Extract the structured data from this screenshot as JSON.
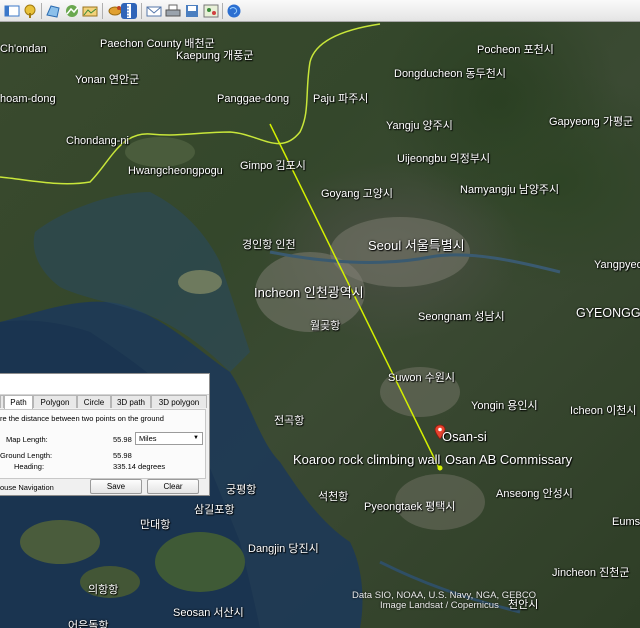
{
  "toolbar": {
    "buttons": [
      {
        "icon": "hide-sidebar-icon",
        "color": "#3b78c9"
      },
      {
        "icon": "add-placemark-icon",
        "color": "#e9c23a"
      },
      {
        "icon": "add-polygon-icon",
        "color": "#4a9ad8"
      },
      {
        "icon": "add-path-icon",
        "color": "#4a9ad8"
      },
      {
        "icon": "add-image-overlay-icon",
        "color": "#6aa84f"
      },
      {
        "icon": "record-tour-icon",
        "color": "#d08a2a"
      },
      {
        "icon": "historical-imagery-icon",
        "color": "#c9782d"
      },
      {
        "icon": "sun-icon",
        "color": "#e0a030"
      },
      {
        "icon": "switch-to-sky-icon",
        "color": "#7a5fb0"
      },
      {
        "icon": "ruler-icon",
        "color": "#2f64b8"
      },
      {
        "icon": "email-icon",
        "color": "#5577aa"
      },
      {
        "icon": "print-icon",
        "color": "#666666"
      },
      {
        "icon": "save-image-icon",
        "color": "#4c7fc0"
      },
      {
        "icon": "view-in-maps-icon",
        "color": "#3a8a3a"
      },
      {
        "icon": "globe-icon",
        "color": "#2c6fd1"
      }
    ]
  },
  "map": {
    "places": [
      {
        "id": "chondan",
        "label": "Ch'ondan"
      },
      {
        "id": "paechon",
        "label": "Paechon County 배천군"
      },
      {
        "id": "kaepung",
        "label": "Kaepung 개풍군"
      },
      {
        "id": "yonan",
        "label": "Yonan 연안군"
      },
      {
        "id": "hoam",
        "label": "hoam-dong"
      },
      {
        "id": "panggae",
        "label": "Panggae-dong"
      },
      {
        "id": "paju",
        "label": "Paju 파주시"
      },
      {
        "id": "pocheon",
        "label": "Pocheon 포천시"
      },
      {
        "id": "dongducheon",
        "label": "Dongducheon 동두천시"
      },
      {
        "id": "yangju",
        "label": "Yangju 양주시"
      },
      {
        "id": "gapyeong",
        "label": "Gapyeong 가평군"
      },
      {
        "id": "chondang",
        "label": "Chondang-ni"
      },
      {
        "id": "uijeongbu",
        "label": "Uijeongbu 의정부시"
      },
      {
        "id": "gimpo",
        "label": "Gimpo 김포시"
      },
      {
        "id": "hwangcheong",
        "label": "Hwangcheongpogu"
      },
      {
        "id": "namyangju",
        "label": "Namyangju 남양주시"
      },
      {
        "id": "goyang",
        "label": "Goyang 고양시"
      },
      {
        "id": "incheon-airport",
        "label": "경인항 인천"
      },
      {
        "id": "seoul",
        "label": "Seoul 서울특별시"
      },
      {
        "id": "yangpyeong",
        "label": "Yangpyeo"
      },
      {
        "id": "incheon",
        "label": "Incheon 인천광역시"
      },
      {
        "id": "seongnam",
        "label": "Seongnam 성남시"
      },
      {
        "id": "gyeonggi",
        "label": "GYEONGGI"
      },
      {
        "id": "wolgot",
        "label": "월곶항"
      },
      {
        "id": "suwon",
        "label": "Suwon 수원시"
      },
      {
        "id": "yongin",
        "label": "Yongin 용인시"
      },
      {
        "id": "icheon",
        "label": "Icheon 이천시"
      },
      {
        "id": "jeongok",
        "label": "전곡항"
      },
      {
        "id": "osan",
        "label": "Osan-si"
      },
      {
        "id": "koaroo",
        "label": "Koaroo rock climbing wall"
      },
      {
        "id": "osan-ab",
        "label": "Osan AB Commissary"
      },
      {
        "id": "anseong",
        "label": "Anseong 안성시"
      },
      {
        "id": "gungpyeong",
        "label": "궁평항"
      },
      {
        "id": "sokcho",
        "label": "석천항"
      },
      {
        "id": "pyeongtaek",
        "label": "Pyeongtaek 평택시"
      },
      {
        "id": "samgilpo",
        "label": "삼길포항"
      },
      {
        "id": "eums",
        "label": "Eums"
      },
      {
        "id": "mandae",
        "label": "만대항"
      },
      {
        "id": "dangjin",
        "label": "Dangjin 당진시"
      },
      {
        "id": "jincheon",
        "label": "Jincheon 진천군"
      },
      {
        "id": "uihang",
        "label": "의항항"
      },
      {
        "id": "seosan",
        "label": "Seosan 서산시"
      },
      {
        "id": "cheonan",
        "label": "천안시"
      },
      {
        "id": "eoeun",
        "label": "어은돌항"
      }
    ],
    "attribution_line1": "Data SIO, NOAA, U.S. Navy, NGA, GEBCO",
    "attribution_line2": "Image Landsat / Copernicus",
    "border_color": "#c8e63a",
    "measure_line_color": "#d4f000",
    "pin_color": "#e8432e"
  },
  "ruler": {
    "tabs": [
      "Path",
      "Polygon",
      "Circle",
      "3D path",
      "3D polygon"
    ],
    "instruction": "re the distance between two points on the ground",
    "map_length_label": "Map Length:",
    "map_length_value": "55.98",
    "units": "Miles",
    "ground_length_label": "Ground Length:",
    "ground_length_value": "55.98",
    "heading_label": "Heading:",
    "heading_value": "335.14 degrees",
    "mouse_navigation_label": "ouse Navigation",
    "save_label": "Save",
    "clear_label": "Clear"
  }
}
